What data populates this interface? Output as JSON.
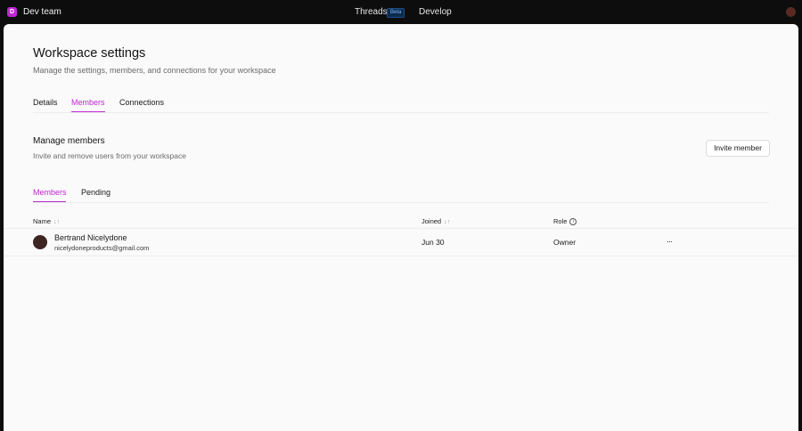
{
  "topbar": {
    "workspace_initial": "D",
    "workspace_name": "Dev team",
    "nav": {
      "threads": "Threads",
      "beta_badge": "Beta",
      "develop": "Develop"
    }
  },
  "page": {
    "title": "Workspace settings",
    "subtitle": "Manage the settings, members, and connections for your workspace",
    "tabs": [
      "Details",
      "Members",
      "Connections"
    ],
    "active_tab": "Members"
  },
  "members_section": {
    "title": "Manage members",
    "subtitle": "Invite and remove users from your workspace",
    "invite_label": "Invite member",
    "subtabs": [
      "Members",
      "Pending"
    ],
    "active_subtab": "Members",
    "columns": {
      "name": "Name",
      "joined": "Joined",
      "role": "Role"
    },
    "rows": [
      {
        "name": "Bertrand Nicelydone",
        "email": "nicelydoneproducts@gmail.com",
        "joined": "Jun 30",
        "role": "Owner",
        "more": "···"
      }
    ]
  },
  "colors": {
    "accent": "#c026d3",
    "background": "#fafafa",
    "topbar": "#0d0d0d"
  }
}
